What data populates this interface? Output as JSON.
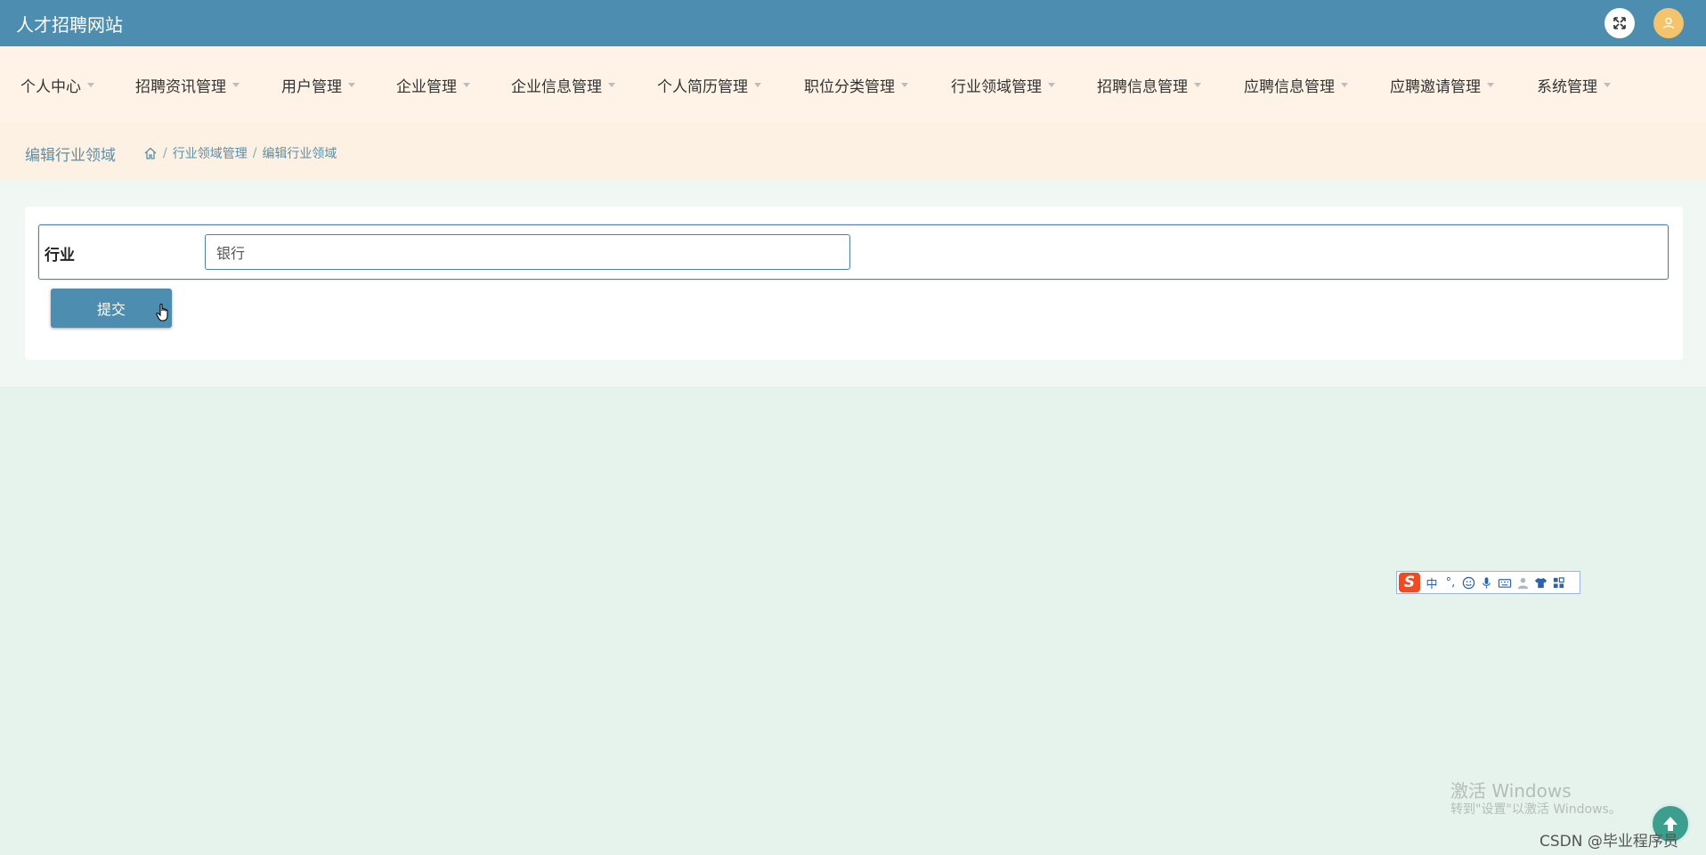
{
  "header": {
    "site_title": "人才招聘网站",
    "expand_icon": "expand-arrows-icon",
    "user_icon": "user-icon"
  },
  "nav": {
    "items": [
      {
        "label": "个人中心"
      },
      {
        "label": "招聘资讯管理"
      },
      {
        "label": "用户管理"
      },
      {
        "label": "企业管理"
      },
      {
        "label": "企业信息管理"
      },
      {
        "label": "个人简历管理"
      },
      {
        "label": "职位分类管理"
      },
      {
        "label": "行业领域管理"
      },
      {
        "label": "招聘信息管理"
      },
      {
        "label": "应聘信息管理"
      },
      {
        "label": "应聘邀请管理"
      },
      {
        "label": "系统管理"
      }
    ]
  },
  "breadcrumb": {
    "page_title": "编辑行业领域",
    "home_icon": "home-icon",
    "separator": "/",
    "trail": [
      "行业领域管理",
      "编辑行业领域"
    ]
  },
  "form": {
    "industry_label": "行业",
    "industry_value": "银行",
    "submit_label": "提交"
  },
  "ime": {
    "logo": "S",
    "mode": "中",
    "punct": "°,",
    "icons": [
      "smile-icon",
      "microphone-icon",
      "keyboard-icon",
      "user-icon",
      "shirt-icon",
      "grid-icon"
    ]
  },
  "watermark": {
    "title": "激活 Windows",
    "subtitle": "转到\"设置\"以激活 Windows。"
  },
  "credit": "CSDN @毕业程序员",
  "colors": {
    "primary": "#4c8db0",
    "nav_bg": "#fef3e6",
    "page_bg": "#e6f2ec",
    "user_badge": "#f5c36b"
  }
}
